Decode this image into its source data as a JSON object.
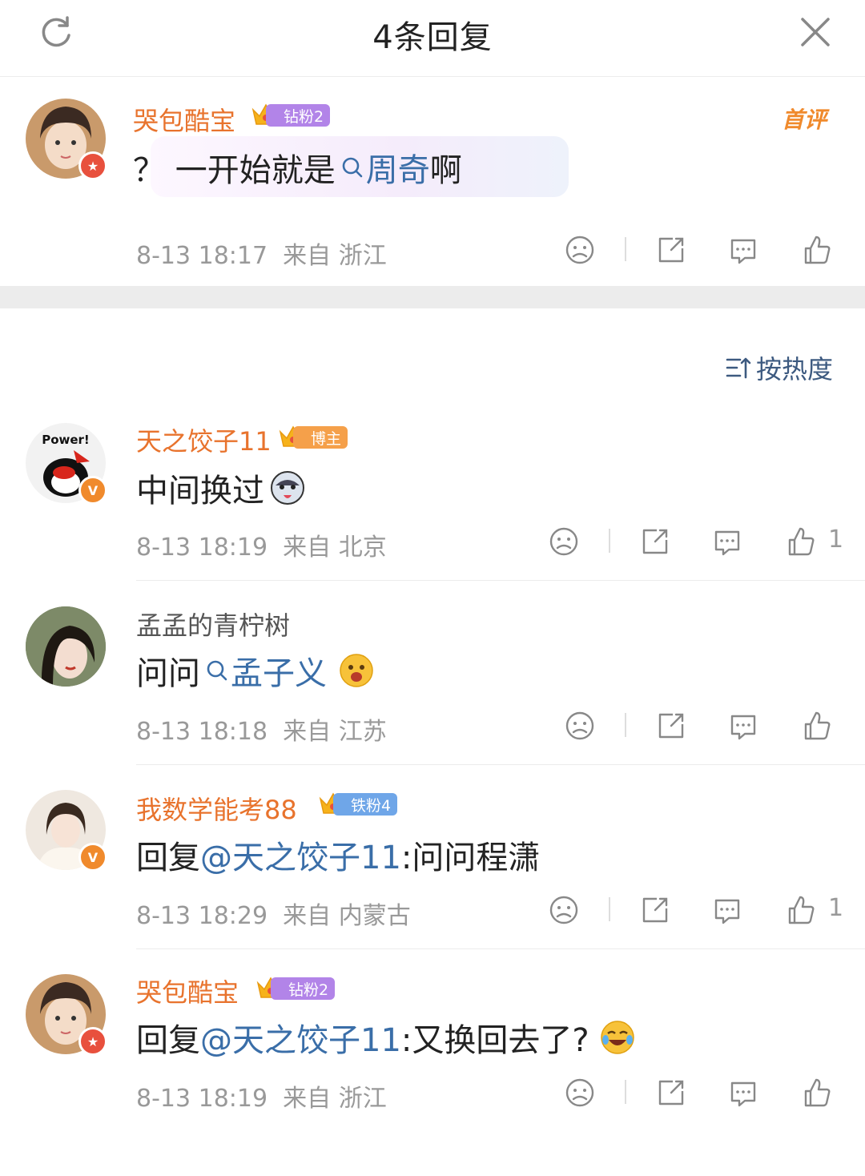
{
  "header": {
    "title": "4条回复"
  },
  "root_comment": {
    "username": "哭包酷宝",
    "fan_badge": "钻粉2",
    "first_badge": "首评",
    "text_prefix": "？ 一开始就是",
    "topic": "周奇",
    "text_suffix": " 啊",
    "time": "8-13 18:17",
    "location": "来自 浙江"
  },
  "sort": {
    "label": "按热度"
  },
  "replies": [
    {
      "username": "天之饺子11",
      "fan_badge": "博主",
      "text": "中间换过",
      "time": "8-13 18:19",
      "location": "来自 北京",
      "likes": "1"
    },
    {
      "username": "孟孟的青柠树",
      "text": "问问",
      "topic": "孟子义",
      "time": "8-13 18:18",
      "location": "来自 江苏"
    },
    {
      "username": "我数学能考88",
      "fan_badge": "铁粉4",
      "reply_prefix": "回复",
      "mention": "@天之饺子11",
      "text": ":问问程潇",
      "time": "8-13 18:29",
      "location": "来自 内蒙古",
      "likes": "1"
    },
    {
      "username": "哭包酷宝",
      "fan_badge": "钻粉2",
      "reply_prefix": "回复",
      "mention": "@天之饺子11",
      "text": ":又换回去了?",
      "time": "8-13 18:19",
      "location": "来自 浙江"
    }
  ],
  "colors": {
    "accent_orange": "#e8732d",
    "link_blue": "#3a6ea8",
    "badge_purple": "#b284e8",
    "badge_orange": "#f5a04a",
    "badge_blue": "#6fa6e8",
    "meta_gray": "#999999"
  },
  "icons": [
    "refresh-icon",
    "close-icon",
    "dislike-icon",
    "share-icon",
    "comment-icon",
    "like-icon",
    "sort-icon",
    "search-topic-icon"
  ]
}
